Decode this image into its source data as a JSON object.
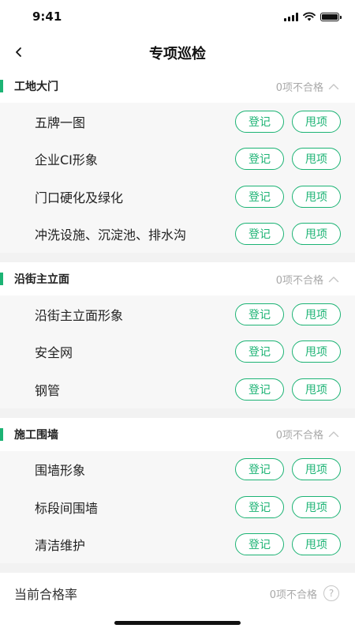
{
  "status_bar": {
    "time": "9:41"
  },
  "nav": {
    "title": "专项巡检"
  },
  "actions": {
    "register_label": "登记",
    "push_label": "甩项"
  },
  "sections": [
    {
      "title": "工地大门",
      "status": "0项不合格",
      "items": [
        {
          "label": "五牌一图"
        },
        {
          "label": "企业CI形象"
        },
        {
          "label": "门口硬化及绿化"
        },
        {
          "label": "冲洗设施、沉淀池、排水沟"
        }
      ]
    },
    {
      "title": "沿街主立面",
      "status": "0项不合格",
      "items": [
        {
          "label": "沿街主立面形象"
        },
        {
          "label": "安全网"
        },
        {
          "label": "钢管"
        }
      ]
    },
    {
      "title": "施工围墙",
      "status": "0项不合格",
      "items": [
        {
          "label": "围墙形象"
        },
        {
          "label": "标段间围墙"
        },
        {
          "label": "清洁维护"
        }
      ]
    }
  ],
  "summary": {
    "label": "当前合格率",
    "status": "0项不合格",
    "help_glyph": "?"
  },
  "colors": {
    "accent": "#1cb374",
    "muted": "#a8a8a8",
    "section_bg": "#f7f7f7"
  },
  "icons": {
    "back": "back-arrow-icon",
    "collapse": "chevron-up-icon",
    "help": "question-circle-icon"
  }
}
